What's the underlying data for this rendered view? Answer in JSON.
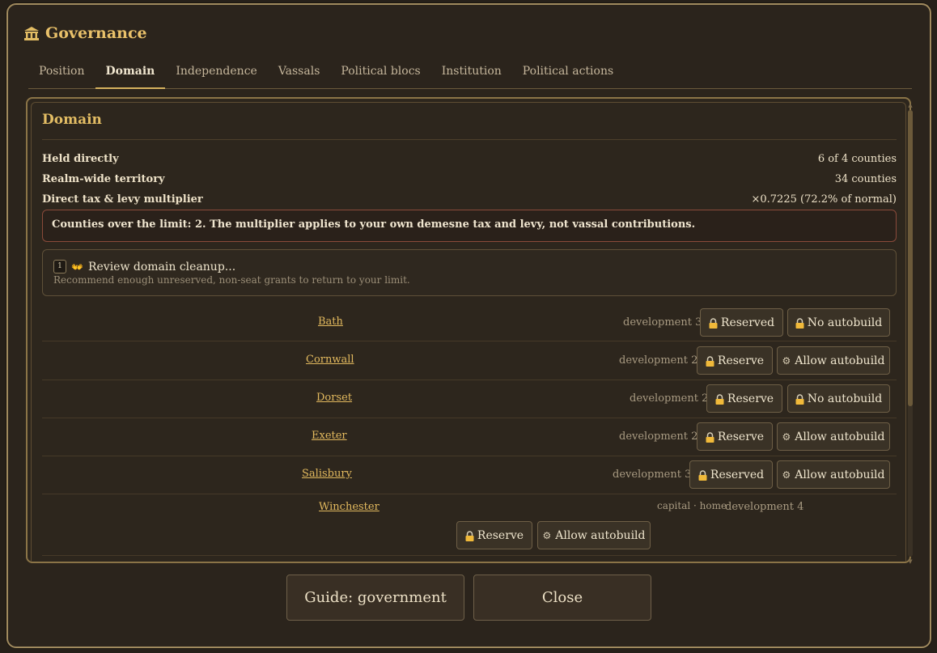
{
  "window": {
    "title": "Governance",
    "icon": "government-building-icon"
  },
  "tabs": [
    {
      "label": "Position"
    },
    {
      "label": "Domain"
    },
    {
      "label": "Independence"
    },
    {
      "label": "Vassals"
    },
    {
      "label": "Political blocs"
    },
    {
      "label": "Institution"
    },
    {
      "label": "Political actions"
    }
  ],
  "active_tab": "Domain",
  "domain": {
    "heading": "Domain",
    "stats": [
      {
        "label": "Held directly",
        "value": "6 of 4 counties"
      },
      {
        "label": "Realm-wide territory",
        "value": "34 counties"
      },
      {
        "label": "Direct tax & levy multiplier",
        "value": "×0.7225 (72.2% of normal)"
      }
    ],
    "warning": "Counties over the limit: 2. The multiplier applies to your own demesne tax and levy, not vassal contributions.",
    "cleanup": {
      "key": "1",
      "icon": "handshake-icon",
      "icon_glyph": "👐",
      "title": "Review domain cleanup...",
      "description": "Recommend enough unreserved, non-seat grants to return to your limit."
    },
    "counties": [
      {
        "name": "Bath",
        "development": "development 3",
        "reserve": "Reserved",
        "autobuild": "No autobuild",
        "autobuild_icon": "lock"
      },
      {
        "name": "Cornwall",
        "development": "development 2",
        "reserve": "Reserve",
        "autobuild": "Allow autobuild",
        "autobuild_icon": "gear"
      },
      {
        "name": "Dorset",
        "development": "development 2",
        "reserve": "Reserve",
        "autobuild": "No autobuild",
        "autobuild_icon": "lock"
      },
      {
        "name": "Exeter",
        "development": "development 2",
        "reserve": "Reserve",
        "autobuild": "Allow autobuild",
        "autobuild_icon": "gear"
      },
      {
        "name": "Salisbury",
        "development": "development 3",
        "reserve": "Reserved",
        "autobuild": "Allow autobuild",
        "autobuild_icon": "gear"
      },
      {
        "name": "Winchester",
        "tags": "capital · home",
        "development": "development 4",
        "reserve": "Reserve",
        "autobuild": "Allow autobuild",
        "autobuild_icon": "gear"
      }
    ]
  },
  "footer": {
    "guide_label": "Guide: government",
    "close_label": "Close"
  },
  "colors": {
    "accent": "#e3bd64",
    "link": "#e2b95e",
    "warning_border": "#8a4a3a",
    "lock": "#f0b93a"
  },
  "icons": {
    "lock": "lock-icon",
    "gear": "gear-icon",
    "glyph_gear": "⚙"
  }
}
